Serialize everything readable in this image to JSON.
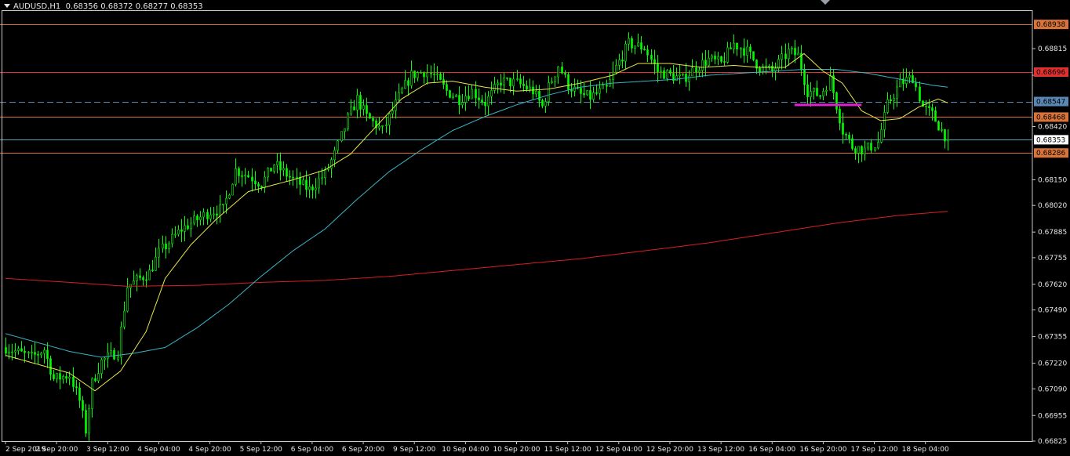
{
  "window": {
    "symbol": "AUDUSD,H1",
    "ohlc": "0.68356 0.68372 0.68277 0.68353"
  },
  "colors": {
    "background": "#000000",
    "candle": "#00ff00",
    "ma_yellow": "#e6e64c",
    "ma_cyan": "#3ab4c6",
    "ma_red": "#d82020",
    "orange_line": "#d8743a",
    "red_line": "#e03030",
    "dashed_line": "#5a86b4",
    "bid_line": "#5aa0b4",
    "magenta_segment": "#e020d0"
  },
  "chart_data": {
    "type": "candlestick",
    "symbol": "AUDUSD",
    "timeframe": "H1",
    "ylim": [
      0.66825,
      0.6901
    ],
    "y_ticks": [
      "0.68815",
      "0.68680",
      "0.68420",
      "0.68150",
      "0.68020",
      "0.67885",
      "0.67755",
      "0.67620",
      "0.67490",
      "0.67355",
      "0.67220",
      "0.67090",
      "0.66955",
      "0.66825"
    ],
    "x_ticks": [
      "2 Sep 2019",
      "2 Sep 20:00",
      "3 Sep 12:00",
      "4 Sep 04:00",
      "4 Sep 20:00",
      "5 Sep 12:00",
      "6 Sep 04:00",
      "6 Sep 20:00",
      "9 Sep 12:00",
      "10 Sep 04:00",
      "10 Sep 20:00",
      "11 Sep 12:00",
      "12 Sep 04:00",
      "12 Sep 20:00",
      "13 Sep 12:00",
      "16 Sep 04:00",
      "16 Sep 20:00",
      "17 Sep 12:00",
      "18 Sep 04:00"
    ],
    "x_tick_index": [
      0,
      16,
      32,
      48,
      64,
      80,
      96,
      112,
      128,
      144,
      160,
      176,
      192,
      208,
      224,
      240,
      256,
      272,
      288
    ],
    "bars": 296,
    "price_path": [
      [
        0,
        0.673
      ],
      [
        8,
        0.6725
      ],
      [
        12,
        0.6729
      ],
      [
        15,
        0.6714
      ],
      [
        20,
        0.6716
      ],
      [
        23,
        0.6703
      ],
      [
        25,
        0.6688
      ],
      [
        27,
        0.6712
      ],
      [
        30,
        0.6723
      ],
      [
        35,
        0.6728
      ],
      [
        38,
        0.6761
      ],
      [
        45,
        0.6768
      ],
      [
        48,
        0.6778
      ],
      [
        52,
        0.6785
      ],
      [
        55,
        0.679
      ],
      [
        60,
        0.6795
      ],
      [
        64,
        0.6799
      ],
      [
        68,
        0.68
      ],
      [
        72,
        0.682
      ],
      [
        76,
        0.6817
      ],
      [
        80,
        0.6813
      ],
      [
        84,
        0.6823
      ],
      [
        90,
        0.6815
      ],
      [
        95,
        0.681
      ],
      [
        100,
        0.6818
      ],
      [
        103,
        0.6828
      ],
      [
        107,
        0.6846
      ],
      [
        110,
        0.6856
      ],
      [
        113,
        0.6847
      ],
      [
        118,
        0.684
      ],
      [
        121,
        0.685
      ],
      [
        124,
        0.686
      ],
      [
        127,
        0.6868
      ],
      [
        131,
        0.687
      ],
      [
        134,
        0.6868
      ],
      [
        138,
        0.686
      ],
      [
        142,
        0.6856
      ],
      [
        146,
        0.686
      ],
      [
        150,
        0.6854
      ],
      [
        155,
        0.6865
      ],
      [
        160,
        0.6864
      ],
      [
        165,
        0.686
      ],
      [
        168,
        0.6852
      ],
      [
        170,
        0.6862
      ],
      [
        173,
        0.6873
      ],
      [
        176,
        0.6863
      ],
      [
        180,
        0.6858
      ],
      [
        183,
        0.6857
      ],
      [
        188,
        0.6861
      ],
      [
        191,
        0.6872
      ],
      [
        195,
        0.6884
      ],
      [
        200,
        0.6882
      ],
      [
        204,
        0.687
      ],
      [
        208,
        0.6868
      ],
      [
        212,
        0.6866
      ],
      [
        216,
        0.6872
      ],
      [
        220,
        0.6876
      ],
      [
        224,
        0.6874
      ],
      [
        228,
        0.6884
      ],
      [
        232,
        0.688
      ],
      [
        236,
        0.6872
      ],
      [
        240,
        0.687
      ],
      [
        245,
        0.688
      ],
      [
        248,
        0.6878
      ],
      [
        251,
        0.686
      ],
      [
        255,
        0.6858
      ],
      [
        258,
        0.6866
      ],
      [
        262,
        0.684
      ],
      [
        265,
        0.6832
      ],
      [
        269,
        0.683
      ],
      [
        273,
        0.6834
      ],
      [
        276,
        0.6853
      ],
      [
        280,
        0.6864
      ],
      [
        284,
        0.6867
      ],
      [
        287,
        0.6852
      ],
      [
        290,
        0.6848
      ],
      [
        293,
        0.684
      ],
      [
        295,
        0.68353
      ]
    ],
    "ma_fast": [
      [
        0,
        0.6726
      ],
      [
        20,
        0.6717
      ],
      [
        28,
        0.6708
      ],
      [
        36,
        0.6718
      ],
      [
        44,
        0.6738
      ],
      [
        50,
        0.6765
      ],
      [
        58,
        0.6782
      ],
      [
        66,
        0.6795
      ],
      [
        76,
        0.6809
      ],
      [
        90,
        0.6815
      ],
      [
        100,
        0.682
      ],
      [
        108,
        0.6828
      ],
      [
        116,
        0.6842
      ],
      [
        124,
        0.6856
      ],
      [
        132,
        0.6864
      ],
      [
        140,
        0.6865
      ],
      [
        150,
        0.6862
      ],
      [
        160,
        0.686
      ],
      [
        170,
        0.6861
      ],
      [
        180,
        0.6864
      ],
      [
        190,
        0.6868
      ],
      [
        198,
        0.6874
      ],
      [
        208,
        0.6874
      ],
      [
        218,
        0.6872
      ],
      [
        228,
        0.6873
      ],
      [
        236,
        0.6872
      ],
      [
        244,
        0.6872
      ],
      [
        250,
        0.6879
      ],
      [
        256,
        0.687
      ],
      [
        262,
        0.6864
      ],
      [
        268,
        0.685
      ],
      [
        274,
        0.6845
      ],
      [
        280,
        0.6846
      ],
      [
        286,
        0.6852
      ],
      [
        292,
        0.6856
      ],
      [
        295,
        0.6854
      ]
    ],
    "ma_mid": [
      [
        0,
        0.6737
      ],
      [
        20,
        0.6728
      ],
      [
        30,
        0.6725
      ],
      [
        40,
        0.6727
      ],
      [
        50,
        0.673
      ],
      [
        60,
        0.674
      ],
      [
        70,
        0.6752
      ],
      [
        80,
        0.6766
      ],
      [
        90,
        0.6779
      ],
      [
        100,
        0.679
      ],
      [
        110,
        0.6805
      ],
      [
        120,
        0.6819
      ],
      [
        130,
        0.683
      ],
      [
        140,
        0.684
      ],
      [
        150,
        0.6847
      ],
      [
        160,
        0.6853
      ],
      [
        170,
        0.6858
      ],
      [
        180,
        0.6862
      ],
      [
        190,
        0.6864
      ],
      [
        200,
        0.6865
      ],
      [
        210,
        0.6866
      ],
      [
        220,
        0.6868
      ],
      [
        230,
        0.6869
      ],
      [
        240,
        0.687
      ],
      [
        250,
        0.6871
      ],
      [
        260,
        0.6871
      ],
      [
        270,
        0.6869
      ],
      [
        280,
        0.6866
      ],
      [
        290,
        0.6863
      ],
      [
        295,
        0.6862
      ]
    ],
    "ma_slow": [
      [
        0,
        0.6765
      ],
      [
        20,
        0.6763
      ],
      [
        38,
        0.6761
      ],
      [
        60,
        0.67615
      ],
      [
        80,
        0.6763
      ],
      [
        100,
        0.6764
      ],
      [
        120,
        0.6766
      ],
      [
        140,
        0.6769
      ],
      [
        160,
        0.6772
      ],
      [
        180,
        0.6775
      ],
      [
        200,
        0.6779
      ],
      [
        220,
        0.6783
      ],
      [
        240,
        0.6788
      ],
      [
        260,
        0.6793
      ],
      [
        280,
        0.6797
      ],
      [
        295,
        0.6799
      ]
    ],
    "h_lines": [
      {
        "price": 0.68938,
        "label": "0.68938",
        "color": "#d8743a",
        "label_bg": "#d8743a",
        "label_fg": "#000000"
      },
      {
        "price": 0.68696,
        "label": "0.68696",
        "color": "#e03030",
        "label_bg": "#e03030",
        "label_fg": "#000000"
      },
      {
        "price": 0.68547,
        "label": "0.68547",
        "color": "#5a86b4",
        "label_bg": "#5a86b4",
        "label_fg": "#000000",
        "dashed": true
      },
      {
        "price": 0.68468,
        "label": "0.68468",
        "color": "#d8743a",
        "label_bg": "#d8743a",
        "label_fg": "#000000"
      },
      {
        "price": 0.68353,
        "label": "0.68353",
        "color": "#5aa0b4",
        "label_bg": "#ffffff",
        "label_fg": "#000000"
      },
      {
        "price": 0.68286,
        "label": "0.68286",
        "color": "#d8743a",
        "label_bg": "#d8743a",
        "label_fg": "#000000"
      }
    ],
    "segment": {
      "price": 0.6853,
      "from": 247,
      "to": 268,
      "color": "#e020d0"
    }
  }
}
